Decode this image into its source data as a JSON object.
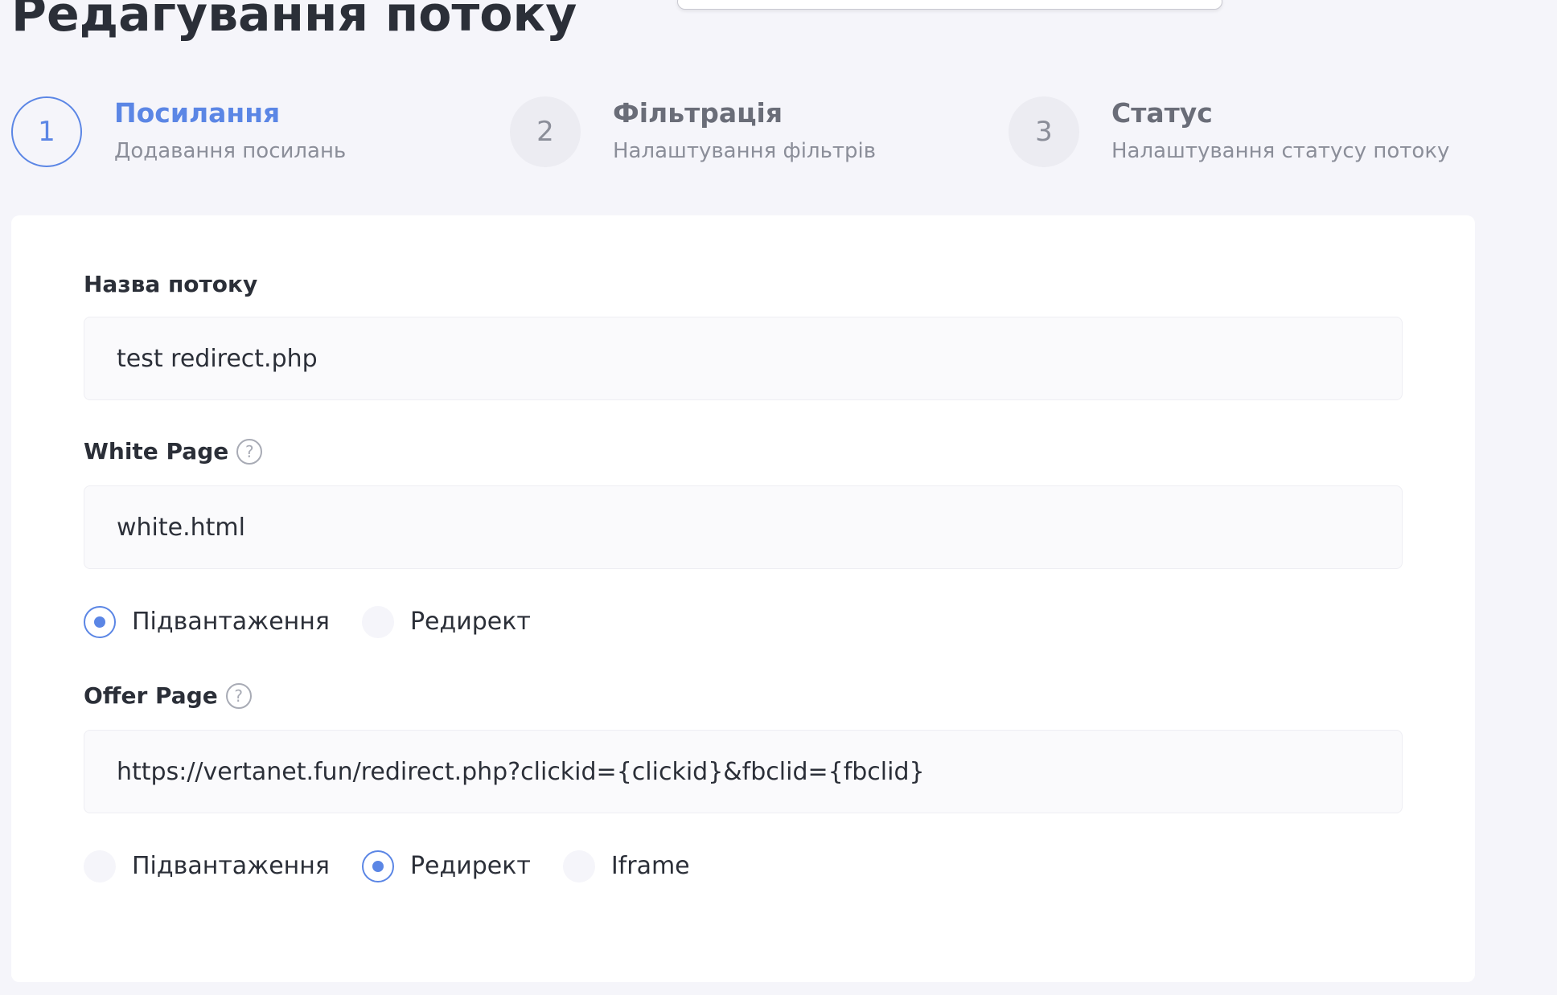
{
  "page": {
    "title": "Редагування потоку"
  },
  "stepper": {
    "steps": [
      {
        "number": "1",
        "title": "Посилання",
        "subtitle": "Додавання посилань",
        "active": true
      },
      {
        "number": "2",
        "title": "Фільтрація",
        "subtitle": "Налаштування фільтрів",
        "active": false
      },
      {
        "number": "3",
        "title": "Статус",
        "subtitle": "Налаштування статусу потоку",
        "active": false
      }
    ]
  },
  "form": {
    "stream_name": {
      "label": "Назва потоку",
      "value": "test redirect.php"
    },
    "white_page": {
      "label": "White Page",
      "help_icon": "?",
      "value": "white.html",
      "options": [
        "Підвантаження",
        "Редирект"
      ],
      "selected": "Підвантаження"
    },
    "offer_page": {
      "label": "Offer Page",
      "help_icon": "?",
      "value": "https://vertanet.fun/redirect.php?clickid={clickid}&fbclid={fbclid}",
      "options": [
        "Підвантаження",
        "Редирект",
        "Iframe"
      ],
      "selected": "Редирект"
    }
  },
  "colors": {
    "accent": "#5b86e5",
    "background": "#f5f5fa",
    "card": "#ffffff",
    "text": "#2b2f38",
    "muted": "#8b8e99"
  }
}
